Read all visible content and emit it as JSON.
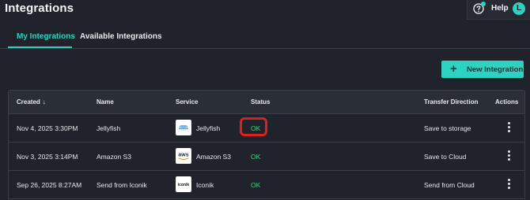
{
  "header": {
    "title": "Integrations",
    "help_label": "Help",
    "avatar_initial": "L"
  },
  "tabs": [
    {
      "label": "My Integrations",
      "active": true
    },
    {
      "label": "Available Integrations",
      "active": false
    }
  ],
  "actions": {
    "new_integration_label": "New Integration",
    "new_integration_icon": "+"
  },
  "table": {
    "columns": {
      "created": "Created",
      "name": "Name",
      "service": "Service",
      "status": "Status",
      "transfer_direction": "Transfer Direction",
      "actions": "Actions"
    },
    "sort_indicator": "↓",
    "rows": [
      {
        "created": "Nov 4, 2025 3:30PM",
        "name": "Jellyfish",
        "service": "Jellyfish",
        "service_logo_text": "Jellyfish",
        "status": "OK",
        "transfer_direction": "Save to storage"
      },
      {
        "created": "Nov 3, 2025 3:14PM",
        "name": "Amazon S3",
        "service": "Amazon S3",
        "service_logo_text": "aws",
        "status": "OK",
        "transfer_direction": "Save to Cloud"
      },
      {
        "created": "Sep 26, 2025 8:27AM",
        "name": "Send from Iconik",
        "service": "Iconik",
        "service_logo_text": "iconik",
        "status": "OK",
        "transfer_direction": "Send from Cloud"
      }
    ]
  },
  "colors": {
    "background": "#20232b",
    "accent": "#2bd3c0",
    "status_ok": "#3fd27a",
    "highlight": "#d8221c"
  }
}
